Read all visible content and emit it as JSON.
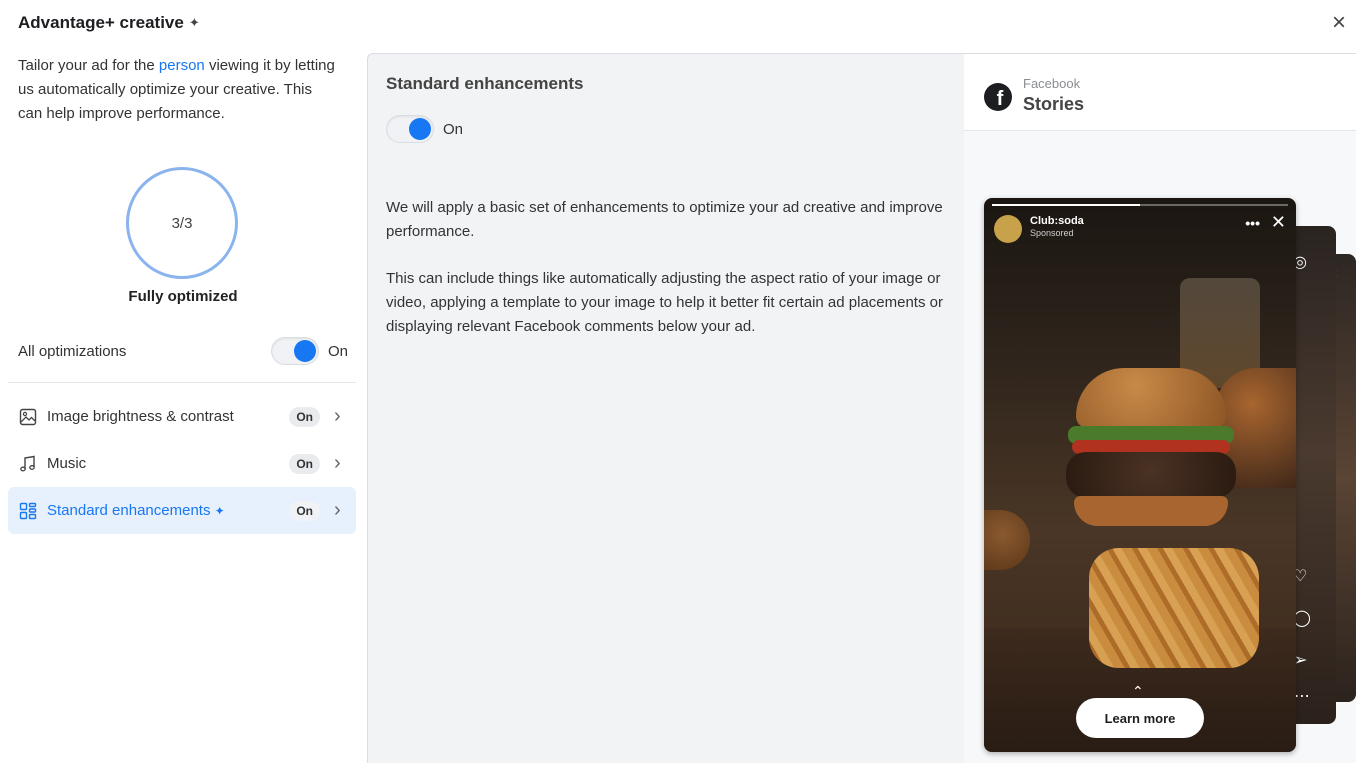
{
  "dialog": {
    "title": "Advantage+ creative",
    "close": "×"
  },
  "left": {
    "intro_before": "Tailor your ad for the ",
    "intro_link": "person",
    "intro_after": " viewing it by letting us automatically optimize your creative. This can help improve performance.",
    "progress_text": "3/3",
    "progress_value": 1.0,
    "progress_label": "Fully optimized",
    "all_optimizations_label": "All optimizations",
    "all_optimizations_state": "On",
    "items": [
      {
        "label": "Image brightness & contrast",
        "status": "On",
        "icon": "image-icon"
      },
      {
        "label": "Music",
        "status": "On",
        "icon": "music-note-icon"
      },
      {
        "label": "Standard enhancements",
        "status": "On",
        "icon": "layout-grid-icon",
        "active": true
      }
    ]
  },
  "middle": {
    "title": "Standard enhancements",
    "toggle_state": "On",
    "paragraph1": "We will apply a basic set of enhancements to optimize your ad creative and improve performance.",
    "paragraph2": "This can include things like automatically adjusting the aspect ratio of your image or video, applying a template to your image to help it better fit certain ad placements or displaying relevant Facebook comments below your ad."
  },
  "preview": {
    "platform": "Facebook",
    "placement": "Stories",
    "brand": "Club:soda",
    "sponsored": "Sponsored",
    "cta": "Learn more"
  },
  "colors": {
    "accent": "#1877f2",
    "active_bg": "#e7f0fd",
    "middle_bg": "#f2f3f5"
  }
}
